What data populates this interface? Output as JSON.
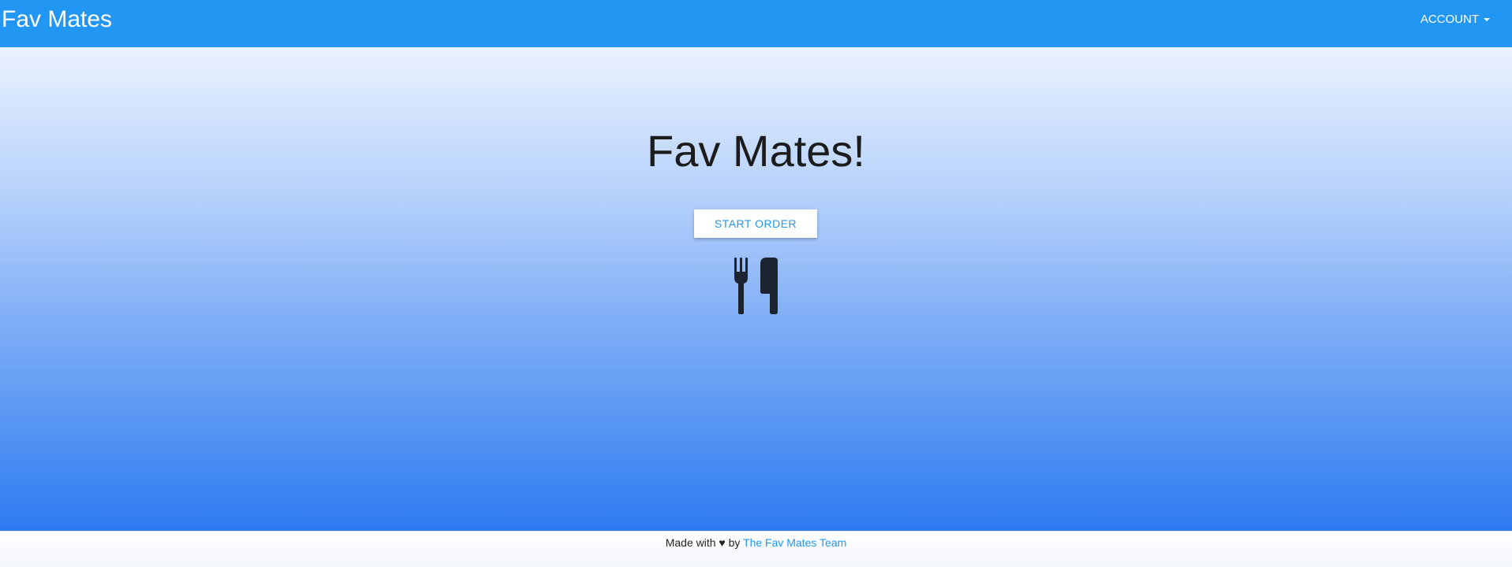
{
  "navbar": {
    "brand": "Fav Mates",
    "account_label": "ACCOUNT"
  },
  "hero": {
    "title": "Fav Mates!",
    "start_button_label": "START ORDER",
    "icon": "cutlery-icon"
  },
  "footer": {
    "prefix": "Made with",
    "heart": "♥",
    "by": "by",
    "team_link": "The Fav Mates Team"
  },
  "colors": {
    "navbar": "#2196f3",
    "accent": "#2196f3",
    "gradient_top": "#eaf2fe",
    "gradient_bottom": "#2d7af1"
  }
}
